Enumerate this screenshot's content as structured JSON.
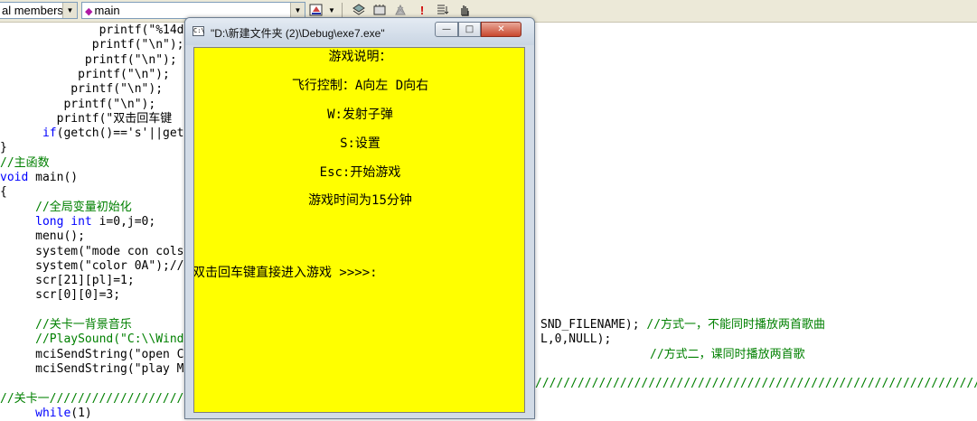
{
  "toolbar": {
    "members_combo": "al members",
    "function_combo": "main",
    "dropdown_arrow": "▼",
    "icons": [
      "class-wizard-icon",
      "dropdown-arrow-icon",
      "compile-icon",
      "build-icon",
      "stop-build-icon",
      "execute-icon",
      "go-icon",
      "breakpoint-icon"
    ]
  },
  "code": [
    {
      "indent": "              ",
      "parts": [
        {
          "t": "printf(\"%14d",
          "c": "n"
        }
      ]
    },
    {
      "indent": "             ",
      "parts": [
        {
          "t": "printf(\"\\n\");",
          "c": "n"
        }
      ]
    },
    {
      "indent": "            ",
      "parts": [
        {
          "t": "printf(\"\\n\");",
          "c": "n"
        }
      ]
    },
    {
      "indent": "           ",
      "parts": [
        {
          "t": "printf(\"\\n\");",
          "c": "n"
        }
      ]
    },
    {
      "indent": "          ",
      "parts": [
        {
          "t": "printf(\"\\n\");",
          "c": "n"
        }
      ]
    },
    {
      "indent": "         ",
      "parts": [
        {
          "t": "printf(\"\\n\");",
          "c": "n"
        }
      ]
    },
    {
      "indent": "        ",
      "parts": [
        {
          "t": "printf(\"双击回车键",
          "c": "n"
        }
      ]
    },
    {
      "indent": "      ",
      "parts": [
        {
          "t": "if",
          "c": "kw"
        },
        {
          "t": "(getch()=='s'||get",
          "c": "n"
        }
      ]
    },
    {
      "indent": "",
      "parts": [
        {
          "t": "}",
          "c": "n"
        }
      ]
    },
    {
      "indent": "",
      "parts": [
        {
          "t": "//主函数",
          "c": "cm"
        }
      ]
    },
    {
      "indent": "",
      "parts": [
        {
          "t": "void",
          "c": "kw"
        },
        {
          "t": " main()",
          "c": "n"
        }
      ]
    },
    {
      "indent": "",
      "parts": [
        {
          "t": "{",
          "c": "n"
        }
      ]
    },
    {
      "indent": "     ",
      "parts": [
        {
          "t": "//全局变量初始化",
          "c": "cm"
        }
      ]
    },
    {
      "indent": "     ",
      "parts": [
        {
          "t": "long int",
          "c": "kw"
        },
        {
          "t": " i=0,j=0;",
          "c": "n"
        }
      ]
    },
    {
      "indent": "     ",
      "parts": [
        {
          "t": "menu();",
          "c": "n"
        }
      ]
    },
    {
      "indent": "     ",
      "parts": [
        {
          "t": "system(\"mode con cols",
          "c": "n"
        }
      ]
    },
    {
      "indent": "     ",
      "parts": [
        {
          "t": "system(\"color 0A\");//",
          "c": "n"
        }
      ]
    },
    {
      "indent": "     ",
      "parts": [
        {
          "t": "scr[21][pl]=1;",
          "c": "n"
        }
      ]
    },
    {
      "indent": "     ",
      "parts": [
        {
          "t": "scr[0][0]=3;",
          "c": "n"
        }
      ]
    },
    {
      "indent": "",
      "parts": []
    },
    {
      "indent": "     ",
      "parts": [
        {
          "t": "//关卡一背景音乐",
          "c": "cm"
        }
      ]
    },
    {
      "indent": "     ",
      "parts": [
        {
          "t": "//PlaySound(\"C:\\\\Wind",
          "c": "cm"
        }
      ]
    },
    {
      "indent": "     ",
      "parts": [
        {
          "t": "mciSendString(\"open C",
          "c": "n"
        }
      ]
    },
    {
      "indent": "     ",
      "parts": [
        {
          "t": "mciSendString(\"play M",
          "c": "n"
        }
      ]
    },
    {
      "indent": "",
      "parts": []
    },
    {
      "indent": "",
      "parts": [
        {
          "t": "//关卡一////////////////////////",
          "c": "cm"
        }
      ]
    },
    {
      "indent": "     ",
      "parts": [
        {
          "t": "while",
          "c": "kw"
        },
        {
          "t": "(1)",
          "c": "n"
        }
      ]
    }
  ],
  "code_right": [
    {
      "line": 20,
      "parts": [
        {
          "t": "SND_FILENAME); ",
          "c": "n"
        },
        {
          "t": "//方式一，不能同时播放两首歌曲",
          "c": "cm"
        }
      ]
    },
    {
      "line": 21,
      "parts": [
        {
          "t": "L,0,NULL);",
          "c": "n"
        }
      ]
    },
    {
      "line": 22,
      "parts": [
        {
          "t": "//方式二，课同时播放两首歌",
          "c": "cm"
        }
      ]
    },
    {
      "line": 24,
      "parts": [
        {
          "t": "//////////////////////////////////////////////////////////////////",
          "c": "cm"
        }
      ]
    }
  ],
  "console": {
    "title": "\"D:\\新建文件夹 (2)\\Debug\\exe7.exe\"",
    "icon_glyph": "C:\\",
    "minimize": "—",
    "maximize": "□",
    "close": "✕",
    "lines": [
      "游戏说明：",
      "飞行控制：A向左 D向右",
      "W:发射子弹",
      "S:设置",
      "Esc:开始游戏",
      "游戏时间为15分钟",
      "双击回车键直接进入游戏 >>>>:"
    ]
  }
}
